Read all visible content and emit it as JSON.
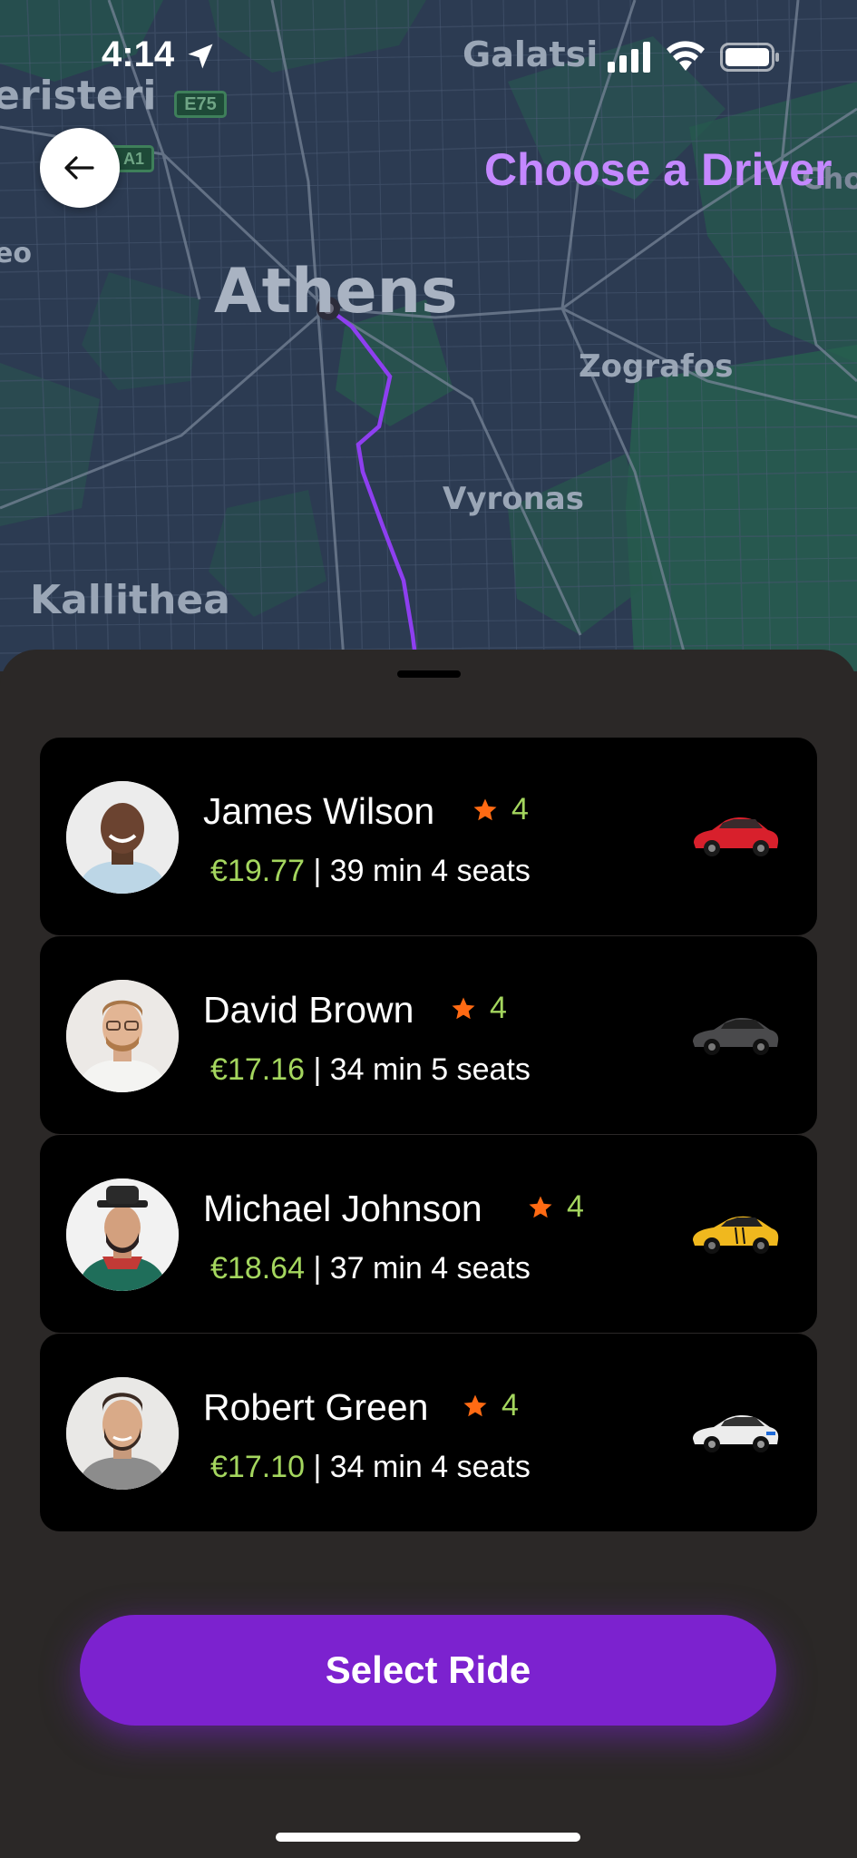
{
  "status_bar": {
    "time": "4:14"
  },
  "map": {
    "labels": {
      "peristeri": "eristeri",
      "galatsi": "Galatsi",
      "athens": "Athens",
      "zografos": "Zografos",
      "vyronas": "Vyronas",
      "kallithea": "Kallithea",
      "geo": "eo",
      "cho": "Cho"
    },
    "road_shields": {
      "e75": "E75",
      "a1": "A1"
    },
    "route_color": "#8e3ff0"
  },
  "header": {
    "title": "Choose a Driver"
  },
  "drivers": [
    {
      "name": "James Wilson",
      "rating": "4",
      "price": "€19.77",
      "details": "| 39 min 4 seats",
      "car_color": "#d8202c"
    },
    {
      "name": "David Brown",
      "rating": "4",
      "price": "€17.16",
      "details": "| 34 min 5 seats",
      "car_color": "#4a4a4c"
    },
    {
      "name": "Michael Johnson",
      "rating": "4",
      "price": "€18.64",
      "details": "| 37 min 4 seats",
      "car_color": "#f0b81e"
    },
    {
      "name": "Robert Green",
      "rating": "4",
      "price": "€17.10",
      "details": "| 34 min 4 seats",
      "car_color": "#ececec"
    }
  ],
  "actions": {
    "select_ride": "Select Ride"
  },
  "colors": {
    "accent": "#7c22cf",
    "title": "#c488ff",
    "price_green": "#a4d65e",
    "star": "#ff6a13"
  }
}
